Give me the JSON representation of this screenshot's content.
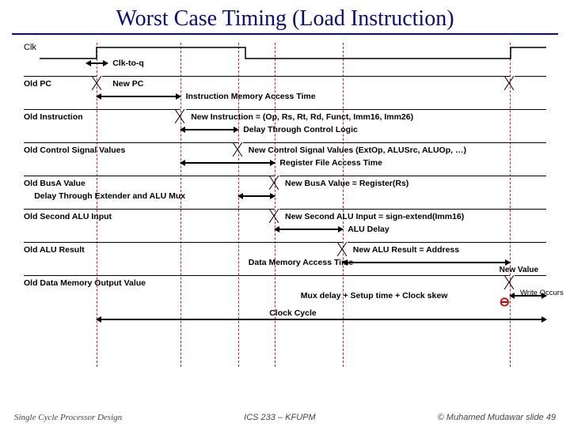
{
  "title": "Worst Case Timing (Load Instruction)",
  "signals": {
    "clk": "Clk",
    "clk_to_q": "Clk-to-q",
    "old_pc": "Old PC",
    "new_pc": "New PC",
    "imem": "Instruction Memory Access Time",
    "old_instr": "Old Instruction",
    "new_instr": "New Instruction = (Op, Rs, Rt, Rd, Funct, Imm16, Imm26)",
    "ctrl_delay": "Delay Through Control Logic",
    "old_ctrl": "Old Control Signal Values",
    "new_ctrl": "New Control Signal Values (ExtOp, ALUSrc, ALUOp, …)",
    "rf_access": "Register File Access Time",
    "old_busa": "Old BusA Value",
    "new_busa": "New BusA Value = Register(Rs)",
    "ext_alu_mux": "Delay Through Extender and ALU Mux",
    "old_alu_in": "Old Second ALU Input",
    "new_alu_in": "New Second ALU Input = sign-extend(Imm16)",
    "alu_delay": "ALU Delay",
    "old_alu_res": "Old ALU Result",
    "new_alu_res": "New ALU Result = Address",
    "dmem": "Data Memory Access Time",
    "old_dmem": "Old Data Memory Output Value",
    "new_val": "New Value",
    "mux_setup": "Mux delay + Setup time + Clock skew",
    "write_occurs": "Write Occurs",
    "clock_cycle": "Clock Cycle"
  },
  "footer": {
    "left": "Single Cycle Processor Design",
    "center": "ICS 233 – KFUPM",
    "right": "© Muhamed Mudawar slide 49"
  },
  "chart_data": {
    "type": "timing-diagram",
    "note": "Schematic timing — positions below are approximate fractions of the cycle width",
    "edges_pct": {
      "clk_rise": 14,
      "pc_valid": 14,
      "instr_valid": 30,
      "ctrl_valid": 41,
      "busa_valid": 48,
      "alu_in_valid": 48,
      "alu_out_valid": 61,
      "dmem_out_valid": 93
    },
    "annotations": [
      {
        "label": "Clk-to-q",
        "from_pct": 14,
        "to_pct": 14
      },
      {
        "label": "Instruction Memory Access Time",
        "from_pct": 14,
        "to_pct": 30
      },
      {
        "label": "Delay Through Control Logic",
        "from_pct": 30,
        "to_pct": 41
      },
      {
        "label": "Register File Access Time",
        "from_pct": 30,
        "to_pct": 48
      },
      {
        "label": "Delay Through Extender and ALU Mux",
        "from_pct": 41,
        "to_pct": 48
      },
      {
        "label": "ALU Delay",
        "from_pct": 48,
        "to_pct": 61
      },
      {
        "label": "Data Memory Access Time",
        "from_pct": 61,
        "to_pct": 93
      },
      {
        "label": "Mux delay + Setup time + Clock skew",
        "from_pct": 93,
        "to_pct": 100
      },
      {
        "label": "Clock Cycle",
        "from_pct": 14,
        "to_pct": 100
      }
    ]
  }
}
